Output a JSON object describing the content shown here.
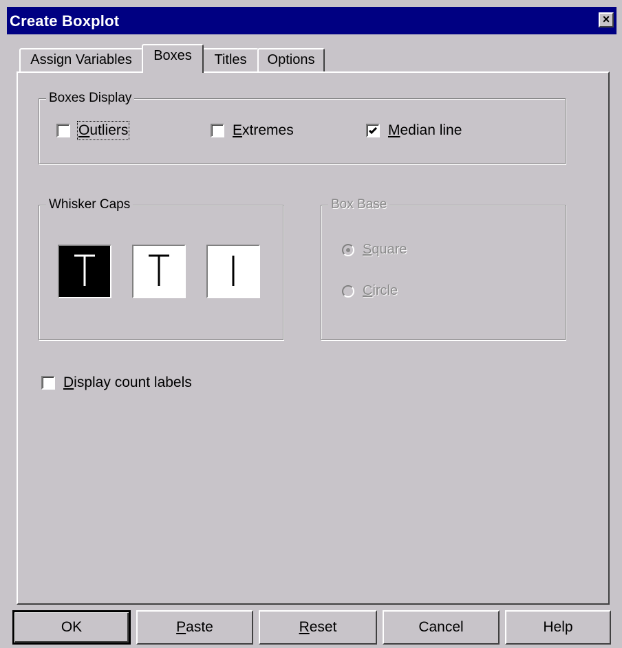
{
  "window": {
    "title": "Create Boxplot",
    "close_label": "×"
  },
  "tabs": [
    {
      "label": "Assign Variables",
      "active": false
    },
    {
      "label": "Boxes",
      "active": true
    },
    {
      "label": "Titles",
      "active": false
    },
    {
      "label": "Options",
      "active": false
    }
  ],
  "boxes_display": {
    "legend": "Boxes Display",
    "outliers": {
      "prefix": "",
      "accel": "O",
      "rest": "utliers",
      "checked": false
    },
    "extremes": {
      "prefix": "",
      "accel": "E",
      "rest": "xtremes",
      "checked": false
    },
    "median_line": {
      "prefix": "",
      "accel": "M",
      "rest": "edian line",
      "checked": true
    }
  },
  "whisker_caps": {
    "legend": "Whisker Caps",
    "options": [
      {
        "icon": "t-cap-wide-icon",
        "selected": true
      },
      {
        "icon": "t-cap-icon",
        "selected": false
      },
      {
        "icon": "line-cap-icon",
        "selected": false
      }
    ]
  },
  "box_base": {
    "legend": "Box Base",
    "enabled": false,
    "square": {
      "accel": "S",
      "rest": "quare",
      "selected": true
    },
    "circle": {
      "accel": "C",
      "rest": "ircle",
      "selected": false
    }
  },
  "display_count": {
    "accel": "D",
    "rest": "isplay count labels",
    "checked": false
  },
  "buttons": {
    "ok": "OK",
    "paste": {
      "accel": "P",
      "rest": "aste"
    },
    "reset": {
      "accel": "R",
      "rest": "eset"
    },
    "cancel": "Cancel",
    "help": "Help"
  },
  "colors": {
    "titlebar": "#000082",
    "face": "#c8c4c9",
    "disabled_text": "#8a8a8a"
  }
}
